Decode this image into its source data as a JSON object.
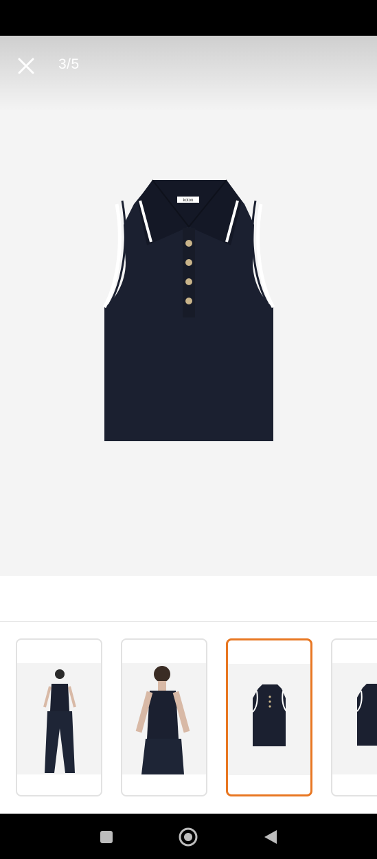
{
  "viewer": {
    "counter": "3/5",
    "close_icon": "close-icon",
    "garment_label": "koton"
  },
  "thumbnails": [
    {
      "id": 1,
      "selected": false
    },
    {
      "id": 2,
      "selected": false
    },
    {
      "id": 3,
      "selected": true
    },
    {
      "id": 4,
      "selected": false
    }
  ],
  "colors": {
    "accent": "#e87722",
    "garment": "#1b2030",
    "trim": "#ffffff",
    "button_gold": "#c9b48a"
  },
  "nav": {
    "recents_icon": "square-icon",
    "home_icon": "circle-icon",
    "back_icon": "triangle-back-icon"
  }
}
